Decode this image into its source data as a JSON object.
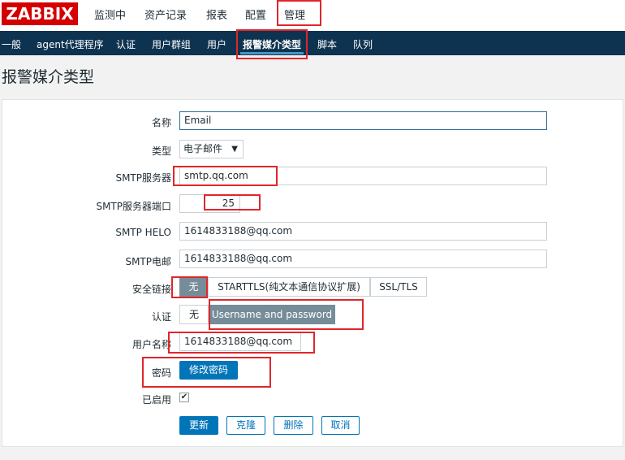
{
  "header": {
    "logo": "ZABBIX",
    "nav": [
      "监测中",
      "资产记录",
      "报表",
      "配置",
      "管理"
    ]
  },
  "subnav": [
    "一般",
    "agent代理程序",
    "认证",
    "用户群组",
    "用户",
    "报警媒介类型",
    "脚本",
    "队列"
  ],
  "page_title": "报警媒介类型",
  "form": {
    "name_label": "名称",
    "name_value": "Email",
    "type_label": "类型",
    "type_value": "电子邮件",
    "smtp_server_label": "SMTP服务器",
    "smtp_server_value": "smtp.qq.com",
    "smtp_port_label": "SMTP服务器端口",
    "smtp_port_value": "25",
    "smtp_helo_label": "SMTP HELO",
    "smtp_helo_value": "1614833188@qq.com",
    "smtp_email_label": "SMTP电邮",
    "smtp_email_value": "1614833188@qq.com",
    "security_label": "安全链接",
    "security_options": [
      "无",
      "STARTTLS(纯文本通信协议扩展)",
      "SSL/TLS"
    ],
    "auth_label": "认证",
    "auth_options": [
      "无",
      "Username and password"
    ],
    "username_label": "用户名称",
    "username_value": "1614833188@qq.com",
    "password_label": "密码",
    "change_password": "修改密码",
    "enabled_label": "已启用",
    "enabled_checkmark": "✔"
  },
  "actions": {
    "update": "更新",
    "clone": "克隆",
    "delete": "删除",
    "cancel": "取消"
  },
  "colors": {
    "logo_red": "#d40000",
    "subnav_bg": "#0e3350",
    "primary_blue": "#0275b8",
    "annotation_red": "#e0262b"
  }
}
